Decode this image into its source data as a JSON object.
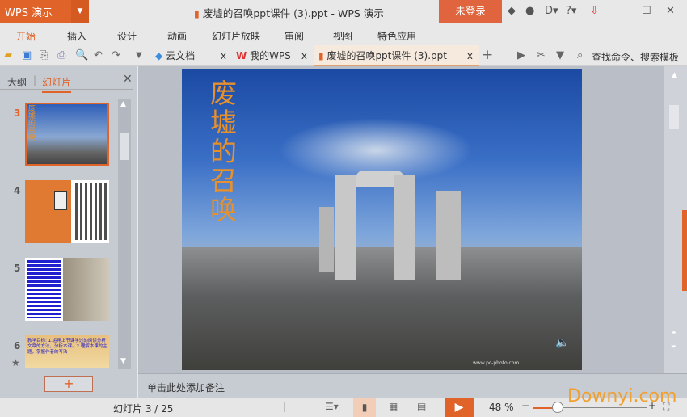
{
  "app": {
    "logo": "WPS 演示",
    "title": "废墟的召唤ppt课件 (3).ppt - WPS 演示",
    "login": "未登录"
  },
  "menu": [
    "开始",
    "插入",
    "设计",
    "动画",
    "幻灯片放映",
    "审阅",
    "视图",
    "特色应用"
  ],
  "doc_tabs": [
    {
      "label": "云文档"
    },
    {
      "label": "我的WPS"
    },
    {
      "label": "废墟的召唤ppt课件 (3).ppt",
      "active": true
    }
  ],
  "search": {
    "placeholder": "查找命令、搜索模板"
  },
  "left_panel": {
    "tabs": [
      "大纲",
      "幻灯片"
    ],
    "active_tab": "幻灯片",
    "slides": [
      {
        "number": "3",
        "selected": true
      },
      {
        "number": "4"
      },
      {
        "number": "5"
      },
      {
        "number": "6",
        "text": "教学目标: 1.运用上节课学过的阅读分析文章的方法，分析本课。2.理解本课的主题，掌握作者的写法"
      }
    ],
    "add_label": "+"
  },
  "slide": {
    "title": "废墟的召唤",
    "watermark": "www.pc-photo.com"
  },
  "notes": {
    "placeholder": "单击此处添加备注"
  },
  "status": {
    "slide_info": "幻灯片 3 / 25",
    "zoom": "48 %",
    "zoom_percent": 48
  },
  "watermark": "Downyi.com",
  "colors": {
    "accent": "#e0642a",
    "title_orange": "#e8902a"
  }
}
